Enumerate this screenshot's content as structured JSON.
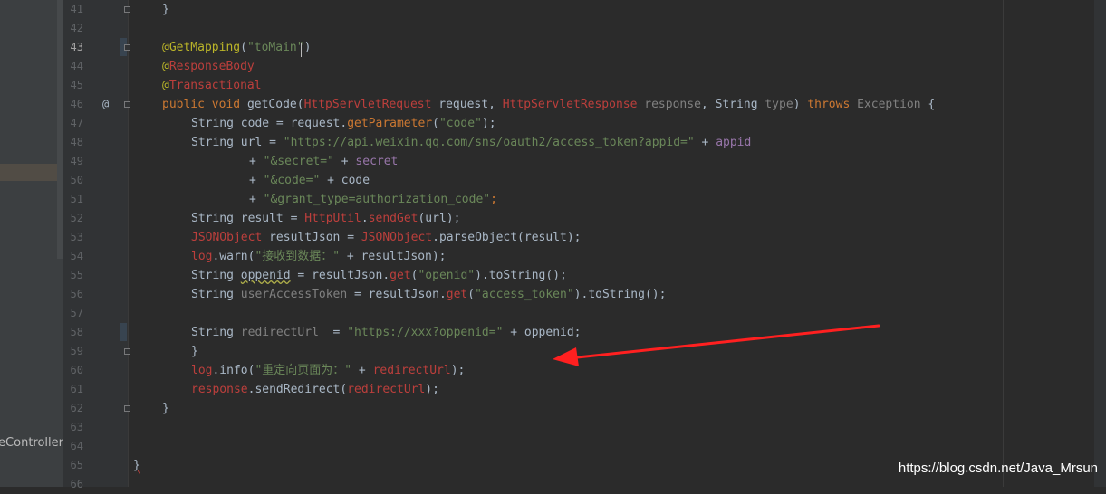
{
  "project_panel": {
    "file_label": "eController"
  },
  "gutter": {
    "line_numbers": [
      "41",
      "42",
      "43",
      "44",
      "45",
      "46",
      "47",
      "48",
      "49",
      "50",
      "51",
      "52",
      "53",
      "54",
      "55",
      "56",
      "57",
      "58",
      "59",
      "60",
      "61",
      "62",
      "63",
      "64",
      "65",
      "66"
    ],
    "override_marker": "@"
  },
  "code": {
    "l41": {
      "brace": "}"
    },
    "l43": {
      "at": "@",
      "annotation": "GetMapping",
      "paren_open": "(",
      "arg": "\"toMain\"",
      "paren_close": ")"
    },
    "l44": {
      "at": "@",
      "annotation": "ResponseBody"
    },
    "l45": {
      "at": "@",
      "annotation": "Transactional"
    },
    "l46": {
      "public": "public",
      "void": "void",
      "method": "getCode(",
      "req_type": "HttpServletRequest",
      "req_name": " request, ",
      "resp_type": "HttpServletResponse",
      "resp_name": " response",
      "comma": ", ",
      "string_type": "String ",
      "type_name": "type",
      "close": ") ",
      "throws": "throws",
      "exception": " Exception",
      "open": " {"
    },
    "l47": {
      "pre": "String code = request.",
      "call": "getParameter",
      "p1": "(",
      "arg": "\"code\"",
      "p2": ");"
    },
    "l48": {
      "pre": "String url = ",
      "q1": "\"",
      "url": "https://api.weixin.qq.com/sns/oauth2/access_token?appid=",
      "q2": "\"",
      "plus": " + ",
      "field": "appid"
    },
    "l49": {
      "plus": "+ ",
      "arg": "\"&secret=\"",
      "plus2": " + ",
      "field": "secret"
    },
    "l50": {
      "plus": "+ ",
      "arg": "\"&code=\"",
      "rest": " + code"
    },
    "l51": {
      "plus": "+ ",
      "arg": "\"&grant_type=authorization_code\"",
      "semi": ";"
    },
    "l52": {
      "pre": "String result = ",
      "cls": "HttpUtil",
      "dot": ".",
      "call": "sendGet",
      "rest": "(url);"
    },
    "l53": {
      "cls": "JSONObject",
      "mid": " resultJson = ",
      "cls2": "JSONObject",
      "rest": ".parseObject(result);"
    },
    "l54": {
      "log": "log",
      "mid": ".warn(",
      "arg": "\"接收到数据：\"",
      "rest": " + resultJson);"
    },
    "l55": {
      "pre": "String ",
      "var": "oppenid",
      "mid": " = resultJson.",
      "call": "get",
      "p1": "(",
      "arg": "\"openid\"",
      "rest": ").toString();"
    },
    "l56": {
      "pre": "String ",
      "var": "userAccessToken",
      "mid": " = resultJson.",
      "call": "get",
      "p1": "(",
      "arg": "\"access_token\"",
      "rest": ").toString();"
    },
    "l58": {
      "pre": "String ",
      "var": "redirectUrl",
      "mid": "  = ",
      "q1": "\"",
      "url": "https://xxx?oppenid=",
      "q2": "\"",
      "rest": " + oppenid;"
    },
    "l59": {
      "brace": "}"
    },
    "l60": {
      "log": "log",
      "mid": ".info(",
      "arg": "\"重定向页面为：\"",
      "plus": " + ",
      "var": "redirectUrl",
      "rest": ");"
    },
    "l61": {
      "obj": "response",
      "mid": ".sendRedirect(",
      "var": "redirectUrl",
      "rest": ");"
    },
    "l62": {
      "brace": "}"
    },
    "l65": {
      "brace": "}"
    }
  },
  "colors": {
    "background": "#2b2b2b",
    "keyword": "#cc7832",
    "string": "#6a8759",
    "error_red": "#bc3f3c",
    "field": "#9876aa",
    "annotation": "#bbb529",
    "arrow": "#ff2020"
  },
  "watermark": "https://blog.csdn.net/Java_Mrsun"
}
